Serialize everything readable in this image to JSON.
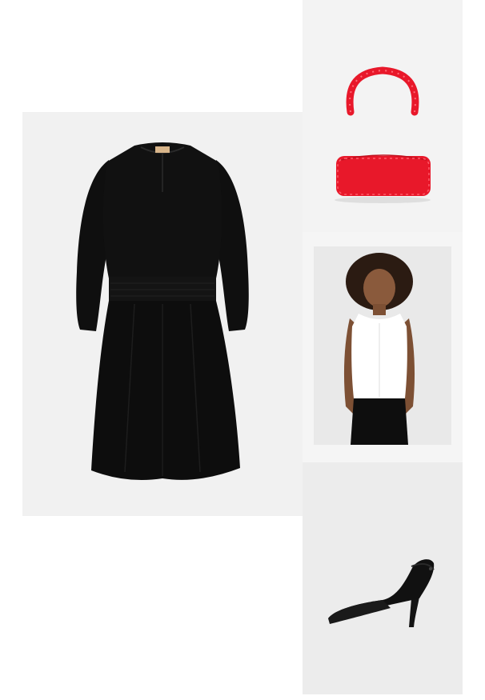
{
  "collage": {
    "items": [
      {
        "name": "black-dress",
        "color": "#0d0d0d",
        "label_text": ""
      },
      {
        "name": "red-beaded-bag",
        "color": "#e8182a"
      },
      {
        "name": "white-tank-top",
        "color": "#ffffff"
      },
      {
        "name": "black-slingback-pump",
        "color": "#111111"
      }
    ],
    "background": "#ffffff",
    "tile_background": "#f1f1f1"
  }
}
